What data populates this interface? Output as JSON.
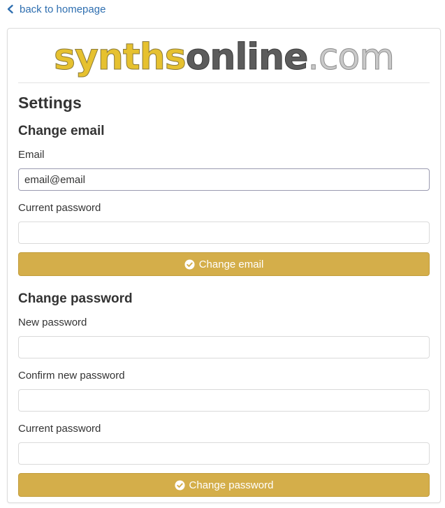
{
  "nav": {
    "back_label": "back to homepage"
  },
  "logo": {
    "part1": "synths",
    "part2": "online",
    "part3": ".com"
  },
  "page": {
    "title": "Settings"
  },
  "email_section": {
    "title": "Change email",
    "email_label": "Email",
    "email_value": "email@email",
    "current_password_label": "Current password",
    "button_label": "Change email"
  },
  "password_section": {
    "title": "Change password",
    "new_password_label": "New password",
    "confirm_password_label": "Confirm new password",
    "current_password_label": "Current password",
    "button_label": "Change password"
  },
  "colors": {
    "accent": "#d4ae4a",
    "link": "#2f6fb0",
    "logo_yellow": "#e6c12f"
  },
  "icons": {
    "back": "chevron-left-icon",
    "button": "check-circle-icon"
  }
}
